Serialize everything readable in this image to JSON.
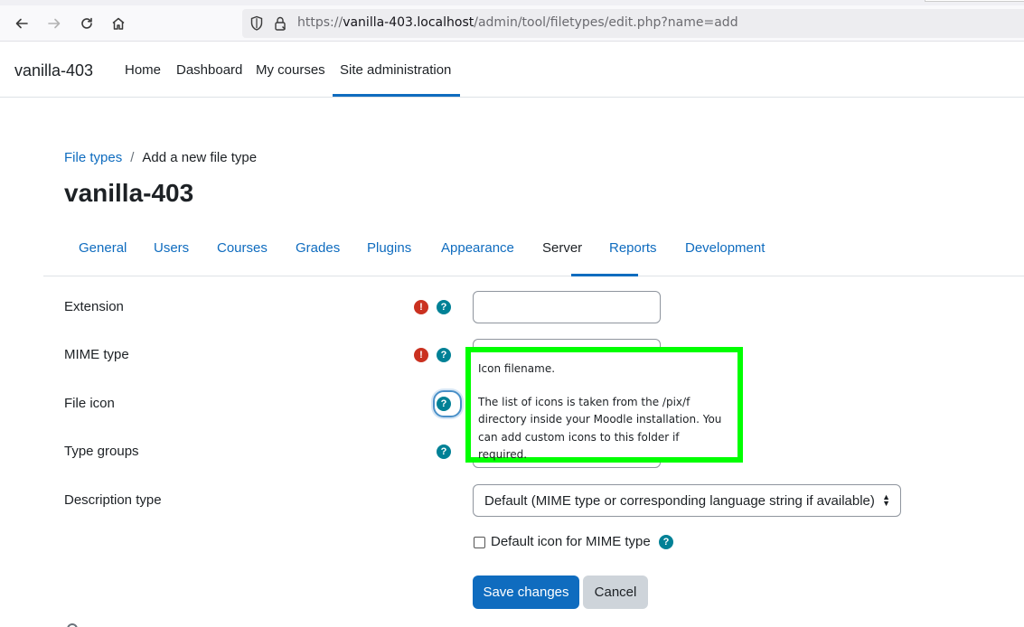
{
  "browser": {
    "url_prefix": "https://",
    "url_host": "vanilla-403.localhost",
    "url_path": "/admin/tool/filetypes/edit.php?name=add"
  },
  "navbar": {
    "site_name": "vanilla-403",
    "items": [
      {
        "label": "Home"
      },
      {
        "label": "Dashboard"
      },
      {
        "label": "My courses"
      },
      {
        "label": "Site administration",
        "active": true
      }
    ]
  },
  "breadcrumb": {
    "parent": "File types",
    "separator": "/",
    "current": "Add a new file type"
  },
  "page_title": "vanilla-403",
  "tabs": [
    {
      "label": "General"
    },
    {
      "label": "Users"
    },
    {
      "label": "Courses"
    },
    {
      "label": "Grades"
    },
    {
      "label": "Plugins"
    },
    {
      "label": "Appearance"
    },
    {
      "label": "Server",
      "active": true
    },
    {
      "label": "Reports"
    },
    {
      "label": "Development"
    }
  ],
  "form": {
    "extension_label": "Extension",
    "mime_label": "MIME type",
    "file_icon_label": "File icon",
    "type_groups_label": "Type groups",
    "description_type_label": "Description type",
    "description_type_value": "Default (MIME type or corresponding language string if available)",
    "default_icon_label": "Default icon for MIME type",
    "save_label": "Save changes",
    "cancel_label": "Cancel"
  },
  "icons": {
    "required": "!",
    "help": "?"
  },
  "popover": {
    "title": "Icon filename.",
    "body": "The list of icons is taken from the /pix/f directory inside your Moodle installation. You can add custom icons to this folder if required."
  },
  "colors": {
    "brand": "#0f6cbf",
    "required": "#ca3120",
    "help": "#008196",
    "highlight": "#00ff00"
  }
}
